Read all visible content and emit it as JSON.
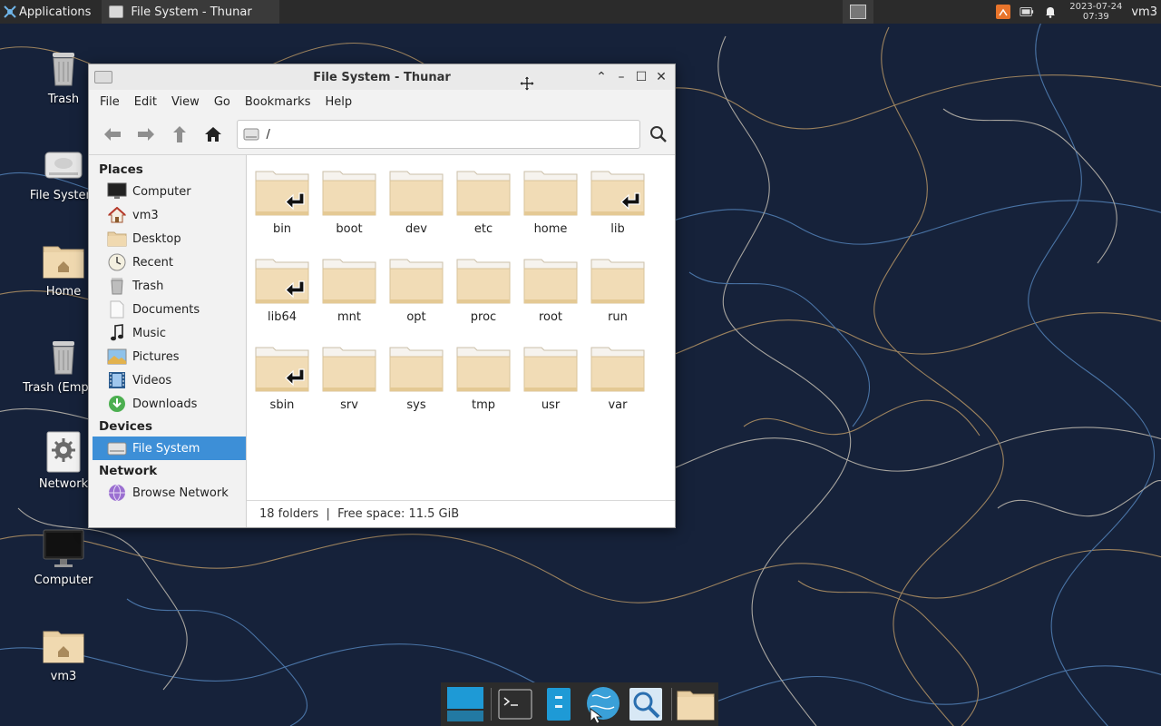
{
  "panel": {
    "applications_label": "Applications",
    "task_label": "File System - Thunar",
    "date": "2023-07-24",
    "time": "07:39",
    "user": "vm3"
  },
  "desktop": {
    "icons": [
      {
        "label": "Trash",
        "icon": "trash-icon"
      },
      {
        "label": "File System",
        "icon": "drive-icon"
      },
      {
        "label": "Home",
        "icon": "home-folder-icon"
      },
      {
        "label": "Trash (Empty)",
        "icon": "trash-icon"
      },
      {
        "label": "Network",
        "icon": "gear-icon"
      },
      {
        "label": "Computer",
        "icon": "monitor-icon"
      },
      {
        "label": "vm3",
        "icon": "home-folder-icon"
      }
    ]
  },
  "window": {
    "title": "File System - Thunar",
    "menu": [
      "File",
      "Edit",
      "View",
      "Go",
      "Bookmarks",
      "Help"
    ],
    "location_path": "/",
    "sidebar": {
      "places_heading": "Places",
      "places": [
        {
          "label": "Computer",
          "icon": "monitor-icon"
        },
        {
          "label": "vm3",
          "icon": "home-icon"
        },
        {
          "label": "Desktop",
          "icon": "desktop-folder-icon"
        },
        {
          "label": "Recent",
          "icon": "clock-icon"
        },
        {
          "label": "Trash",
          "icon": "trash-icon"
        },
        {
          "label": "Documents",
          "icon": "document-icon"
        },
        {
          "label": "Music",
          "icon": "music-note-icon"
        },
        {
          "label": "Pictures",
          "icon": "picture-icon"
        },
        {
          "label": "Videos",
          "icon": "film-icon"
        },
        {
          "label": "Downloads",
          "icon": "download-icon"
        }
      ],
      "devices_heading": "Devices",
      "devices": [
        {
          "label": "File System",
          "icon": "drive-icon",
          "selected": true
        }
      ],
      "network_heading": "Network",
      "network": [
        {
          "label": "Browse Network",
          "icon": "network-globe-icon"
        }
      ]
    },
    "folders": [
      {
        "name": "bin",
        "symlink": true
      },
      {
        "name": "boot",
        "symlink": false
      },
      {
        "name": "dev",
        "symlink": false
      },
      {
        "name": "etc",
        "symlink": false
      },
      {
        "name": "home",
        "symlink": false
      },
      {
        "name": "lib",
        "symlink": true
      },
      {
        "name": "lib64",
        "symlink": true
      },
      {
        "name": "mnt",
        "symlink": false
      },
      {
        "name": "opt",
        "symlink": false
      },
      {
        "name": "proc",
        "symlink": false
      },
      {
        "name": "root",
        "symlink": false
      },
      {
        "name": "run",
        "symlink": false
      },
      {
        "name": "sbin",
        "symlink": true
      },
      {
        "name": "srv",
        "symlink": false
      },
      {
        "name": "sys",
        "symlink": false
      },
      {
        "name": "tmp",
        "symlink": false
      },
      {
        "name": "usr",
        "symlink": false
      },
      {
        "name": "var",
        "symlink": false
      }
    ],
    "status": "18 folders  |  Free space: 11.5 GiB"
  },
  "dock": {
    "items": [
      "show-desktop-icon",
      "terminal-icon",
      "file-manager-icon",
      "web-browser-icon",
      "app-finder-icon",
      "home-folder-icon"
    ]
  },
  "colors": {
    "selection": "#3d8fd7",
    "folder": "#f0d9b0",
    "panel": "#2b2b2b"
  }
}
